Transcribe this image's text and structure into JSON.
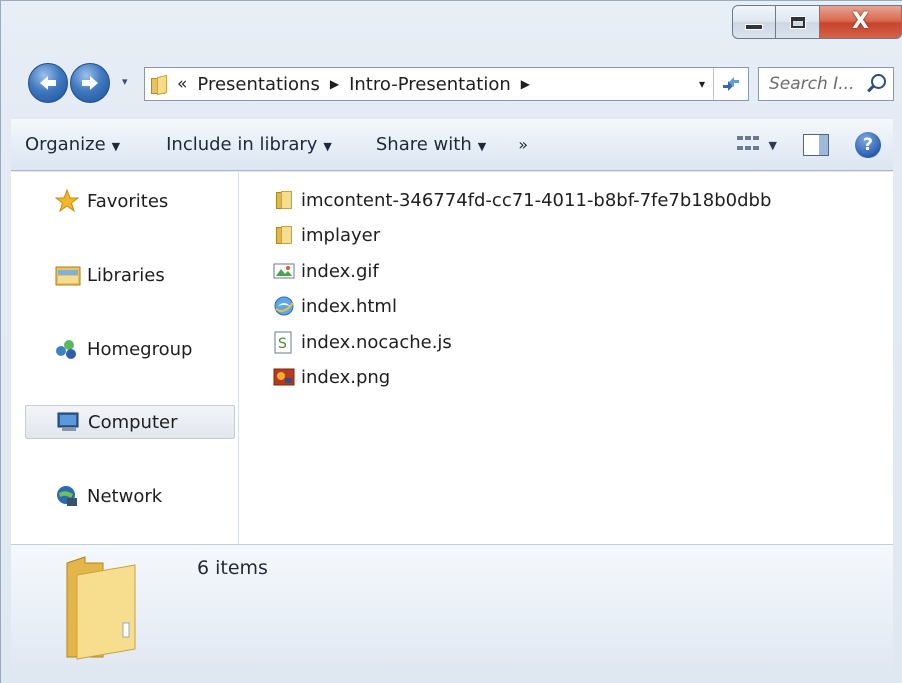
{
  "window": {
    "caption": {
      "minimize_label": "",
      "maximize_label": "",
      "close_label": "X"
    }
  },
  "address": {
    "overflow_chevron": "«",
    "crumbs": [
      "Presentations",
      "Intro-Presentation"
    ],
    "crumb_separator": "▶",
    "dropdown_glyph": "▾"
  },
  "search": {
    "placeholder": "Search I..."
  },
  "toolbar": {
    "organize": "Organize",
    "include_in_library": "Include in library",
    "share_with": "Share with",
    "more": "»",
    "help": "?"
  },
  "navigation": {
    "items": [
      {
        "label": "Favorites",
        "icon": "star-icon",
        "selected": false
      },
      {
        "label": "Libraries",
        "icon": "libraries-icon",
        "selected": false
      },
      {
        "label": "Homegroup",
        "icon": "homegroup-icon",
        "selected": false
      },
      {
        "label": "Computer",
        "icon": "computer-icon",
        "selected": true
      },
      {
        "label": "Network",
        "icon": "network-icon",
        "selected": false
      }
    ]
  },
  "files": [
    {
      "name": "imcontent-346774fd-cc71-4011-b8bf-7fe7b18b0dbb",
      "icon": "folder-icon"
    },
    {
      "name": "implayer",
      "icon": "folder-icon"
    },
    {
      "name": "index.gif",
      "icon": "gif-image-icon"
    },
    {
      "name": "index.html",
      "icon": "html-document-icon"
    },
    {
      "name": "index.nocache.js",
      "icon": "script-file-icon"
    },
    {
      "name": "index.png",
      "icon": "png-image-icon"
    }
  ],
  "details": {
    "item_count": "6 items"
  },
  "colors": {
    "accent": "#3f79c0",
    "folder": "#e2b74a",
    "close_button": "#c7442c",
    "selection": "#e2e7ee"
  }
}
